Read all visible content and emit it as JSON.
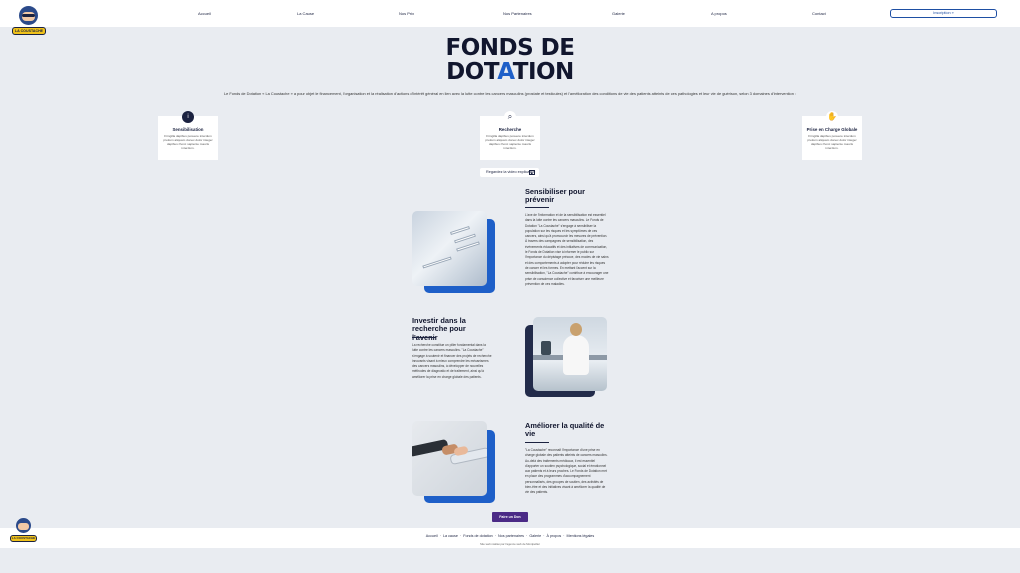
{
  "brand": {
    "logo_text": "LA COUSTACHE"
  },
  "nav": {
    "items": [
      "Accueil",
      "La Cause",
      "Nos Prix",
      "Nos Partenaires",
      "Galerie",
      "A propos",
      "Contact"
    ],
    "cta_label": "Inscription »"
  },
  "hero": {
    "title_line1": "FONDS DE",
    "title_line2_a": "DOT",
    "title_line2_b": "A",
    "title_line2_c": "TION",
    "intro": "Le Fonds de Dotation « La Coustache » a pour objet le financement, l'organisation et la réalisation d'actions d'intérêt général en lien avec la lutte contre les cancers masculins (prostate et testicules) et l'amélioration des conditions de vie des patients atteints de ces pathologies et leur vie de guérison, selon 3 domaines d'intervention :"
  },
  "pillars": [
    {
      "icon": "info-icon",
      "title": "Sensibilisation",
      "text": "Fringilla dapibus posuere interdum pretium aliquam donec dolor integer dapibus rhonc sapiente mauris interdum."
    },
    {
      "icon": "search-icon",
      "title": "Recherche",
      "text": "Fringilla dapibus posuere interdum pretium aliquam donec dolor integer dapibus rhonc sapiente mauris interdum."
    },
    {
      "icon": "hand-coin-icon",
      "title": "Prise en Charge Globale",
      "text": "Fringilla dapibus posuere interdum pretium aliquam donec dolor integer dapibus rhonc sapiente mauris interdum."
    }
  ],
  "video_button": {
    "label": "Regardez la video explicative"
  },
  "sections": [
    {
      "title": "Sensibiliser pour prévenir",
      "text": "L'axe de l'information et de la sensibilisation est essentiel dans la lutte contre les cancers masculins. Le Fonds de Dotation \"La Coustache\" s'engage à sensibiliser la population sur les risques et les symptômes de ces cancers, ainsi qu'à promouvoir les mesures de prévention. À travers des campagnes de sensibilisation, des événements éducatifs et des initiatives de communication, le Fonds de Dotation vise à informer le public sur l'importance du dépistage précoce, des modes de vie sains et des comportements à adopter pour réduire les risques de cancer et les formes. En mettant l'accent sur la sensibilisation, \"La Coustache\" contribue à encourager une prise de conscience collective et favoriser une meilleure prévention de ces maladies."
    },
    {
      "title": "Investir dans la recherche pour l'avenir",
      "text": "La recherche constitue un pilier fondamental dans la lutte contre les cancers masculins. \"La Coustache\" s'engage à soutenir et financer des projets de recherche innovants visant à mieux comprendre les mécanismes des cancers masculins, à développer de nouvelles méthodes de diagnostic et de traitement, ainsi qu'à améliorer la prise en charge globale des patients."
    },
    {
      "title": "Améliorer la qualité de vie",
      "text": "\"La Coustache\" reconnaît l'importance d'une prise en charge globale des patients atteints de cancers masculins. Au-delà des traitements médicaux, il est essentiel d'apporter un soutien psychologique, social et émotionnel aux patients et à leurs proches. Le Fonds de Dotation met en place des programmes d'accompagnement personnalisés, des groupes de soutien, des activités de bien-être et des initiatives visant à améliorer la qualité de vie des patients."
    }
  ],
  "cta": {
    "label": "Faire un Don"
  },
  "footer": {
    "links": [
      "Accueil",
      "La cause",
      "Fonds de dotation",
      "Nos partenaires",
      "Galerie",
      "À propos",
      "Mentions légales"
    ],
    "copyright": "Site web réalisé par l'agence web de Montpellier"
  },
  "colors": {
    "navy": "#1b2240",
    "blue": "#1e5fc8",
    "purple": "#4b2a86",
    "background": "#e9ecf1"
  }
}
